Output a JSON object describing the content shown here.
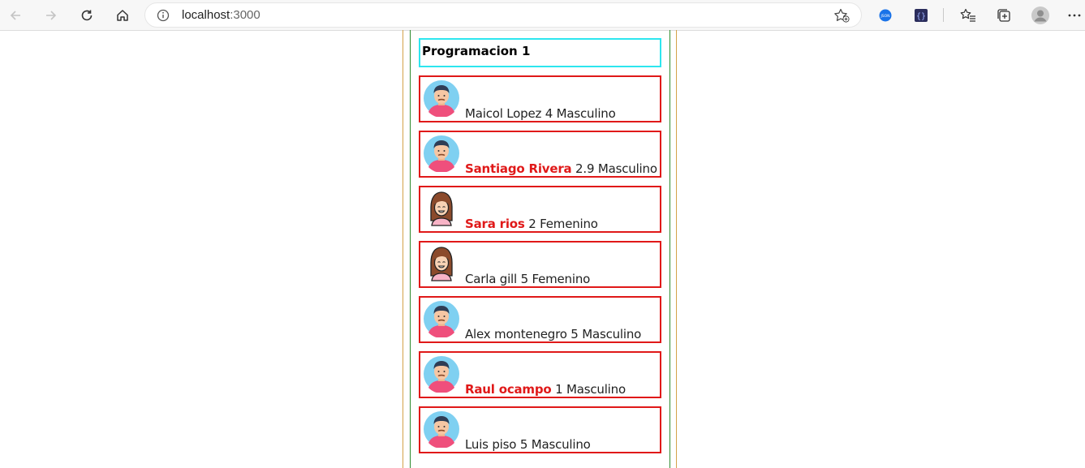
{
  "browser": {
    "url_host": "localhost",
    "url_port": ":3000"
  },
  "page": {
    "title": "Programacion 1",
    "students": [
      {
        "name": "Maicol Lopez",
        "grade": "4",
        "gender": "Masculino",
        "highlight": false,
        "avatar": "male-avatar-icon"
      },
      {
        "name": "Santiago Rivera",
        "grade": "2.9",
        "gender": "Masculino",
        "highlight": true,
        "avatar": "male-avatar-icon"
      },
      {
        "name": "Sara rios",
        "grade": "2",
        "gender": "Femenino",
        "highlight": true,
        "avatar": "female-avatar-icon"
      },
      {
        "name": "Carla gill",
        "grade": "5",
        "gender": "Femenino",
        "highlight": false,
        "avatar": "female-avatar-icon"
      },
      {
        "name": "Alex montenegro",
        "grade": "5",
        "gender": "Masculino",
        "highlight": false,
        "avatar": "male-avatar-icon"
      },
      {
        "name": "Raul ocampo",
        "grade": "1",
        "gender": "Masculino",
        "highlight": true,
        "avatar": "male-avatar-icon"
      },
      {
        "name": "Luis piso",
        "grade": "5",
        "gender": "Masculino",
        "highlight": false,
        "avatar": "male-avatar-icon"
      }
    ]
  },
  "colors": {
    "card_border": "#e01919",
    "title_border": "#2de6ef",
    "highlight_name": "#e01919"
  }
}
